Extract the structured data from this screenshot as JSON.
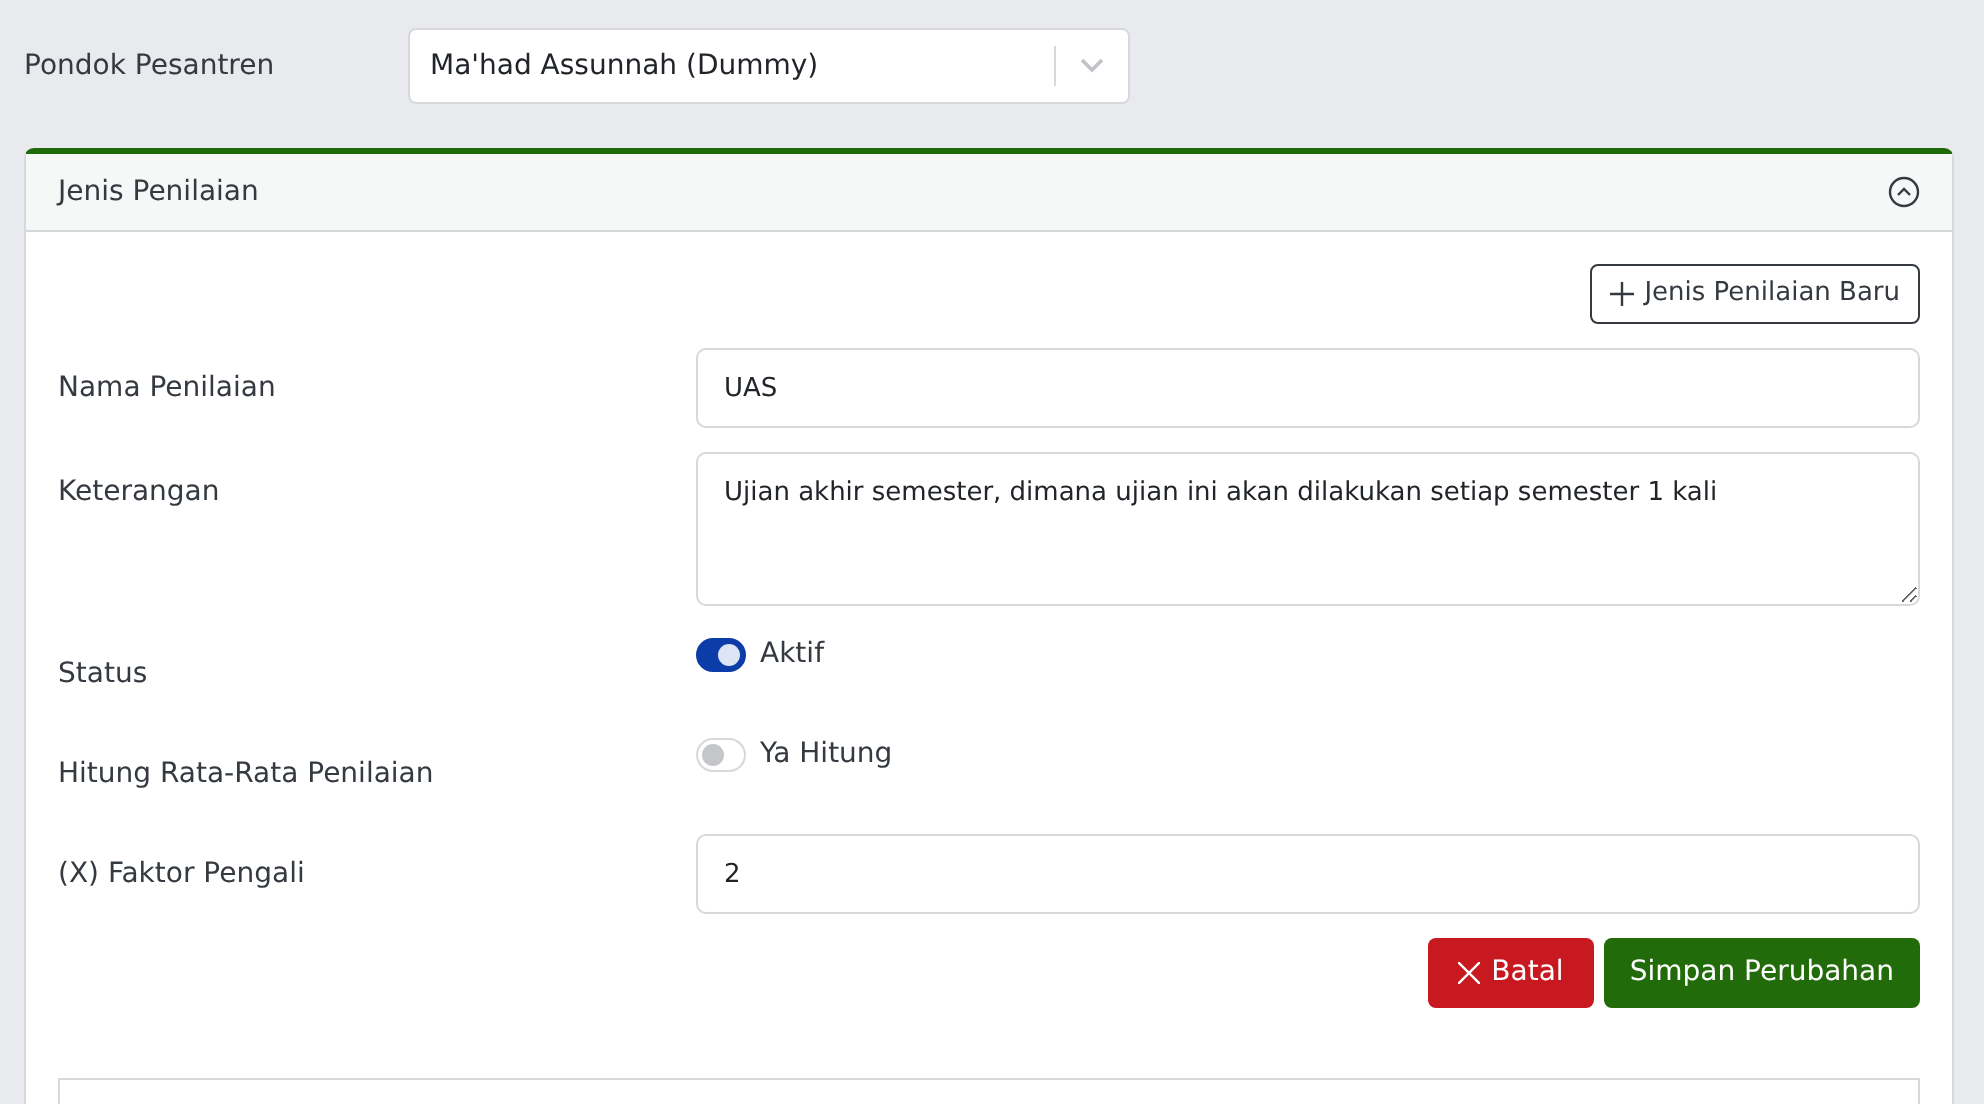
{
  "pesantren": {
    "label": "Pondok Pesantren",
    "value": "Ma'had Assunnah (Dummy)"
  },
  "panel": {
    "title": "Jenis Penilaian",
    "expanded": true
  },
  "new_button": "Jenis Penilaian Baru",
  "fields": [
    {
      "kind": "text",
      "label": "Nama Penilaian",
      "value": "UAS"
    },
    {
      "kind": "textarea",
      "label": "Keterangan",
      "value": "Ujian akhir semester, dimana ujian ini akan dilakukan setiap semester 1 kali"
    },
    {
      "kind": "toggle",
      "label": "Status",
      "text": "Aktif",
      "on": true
    },
    {
      "kind": "toggle",
      "label": "Hitung Rata-Rata Penilaian",
      "text": "Ya Hitung",
      "on": false
    },
    {
      "kind": "text",
      "label": "(X) Faktor Pengali",
      "value": "2"
    }
  ],
  "buttons": {
    "cancel": "Batal",
    "save": "Simpan Perubahan"
  }
}
